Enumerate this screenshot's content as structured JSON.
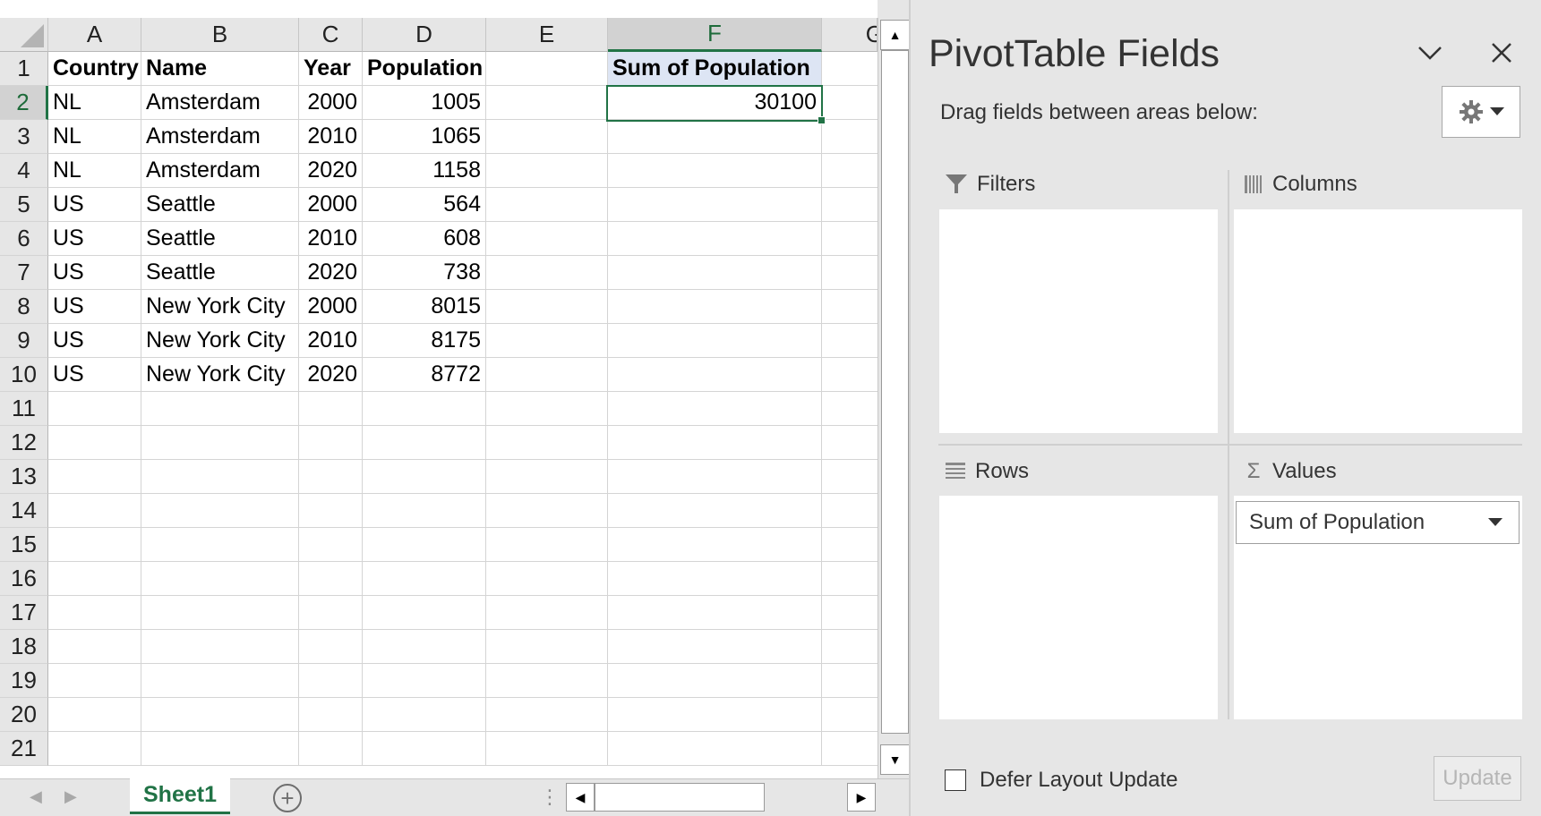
{
  "sheet": {
    "columns": [
      "A",
      "B",
      "C",
      "D",
      "E",
      "F",
      "G"
    ],
    "selected_column": "F",
    "row_numbers": [
      "1",
      "2",
      "3",
      "4",
      "5",
      "6",
      "7",
      "8",
      "9",
      "10",
      "11",
      "12",
      "13",
      "14",
      "15",
      "16",
      "17",
      "18",
      "19",
      "20",
      "21"
    ],
    "selected_row": "2",
    "header_row": {
      "country": "Country",
      "name": "Name",
      "year": "Year",
      "population": "Population"
    },
    "rows": [
      {
        "country": "NL",
        "name": "Amsterdam",
        "year": "2000",
        "population": "1005"
      },
      {
        "country": "NL",
        "name": "Amsterdam",
        "year": "2010",
        "population": "1065"
      },
      {
        "country": "NL",
        "name": "Amsterdam",
        "year": "2020",
        "population": "1158"
      },
      {
        "country": "US",
        "name": "Seattle",
        "year": "2000",
        "population": "564"
      },
      {
        "country": "US",
        "name": "Seattle",
        "year": "2010",
        "population": "608"
      },
      {
        "country": "US",
        "name": "Seattle",
        "year": "2020",
        "population": "738"
      },
      {
        "country": "US",
        "name": "New York City",
        "year": "2000",
        "population": "8015"
      },
      {
        "country": "US",
        "name": "New York City",
        "year": "2010",
        "population": "8175"
      },
      {
        "country": "US",
        "name": "New York City",
        "year": "2020",
        "population": "8772"
      }
    ],
    "pivot": {
      "header": "Sum of Population",
      "value": "30100"
    },
    "tab_name": "Sheet1",
    "add_sheet_symbol": "+",
    "accent_color": "#217346"
  },
  "pane": {
    "title": "PivotTable Fields",
    "drag_hint": "Drag fields between areas below:",
    "areas": {
      "filters": "Filters",
      "columns": "Columns",
      "rows": "Rows",
      "values": "Values"
    },
    "values_item": "Sum of Population",
    "defer_label": "Defer Layout Update",
    "update_label": "Update",
    "icons": {
      "collapse": "chevron-down-icon",
      "close": "close-icon",
      "settings": "gear-icon",
      "filters": "filter-icon",
      "columns": "columns-icon",
      "rows": "rows-icon",
      "values": "sigma-icon"
    }
  }
}
